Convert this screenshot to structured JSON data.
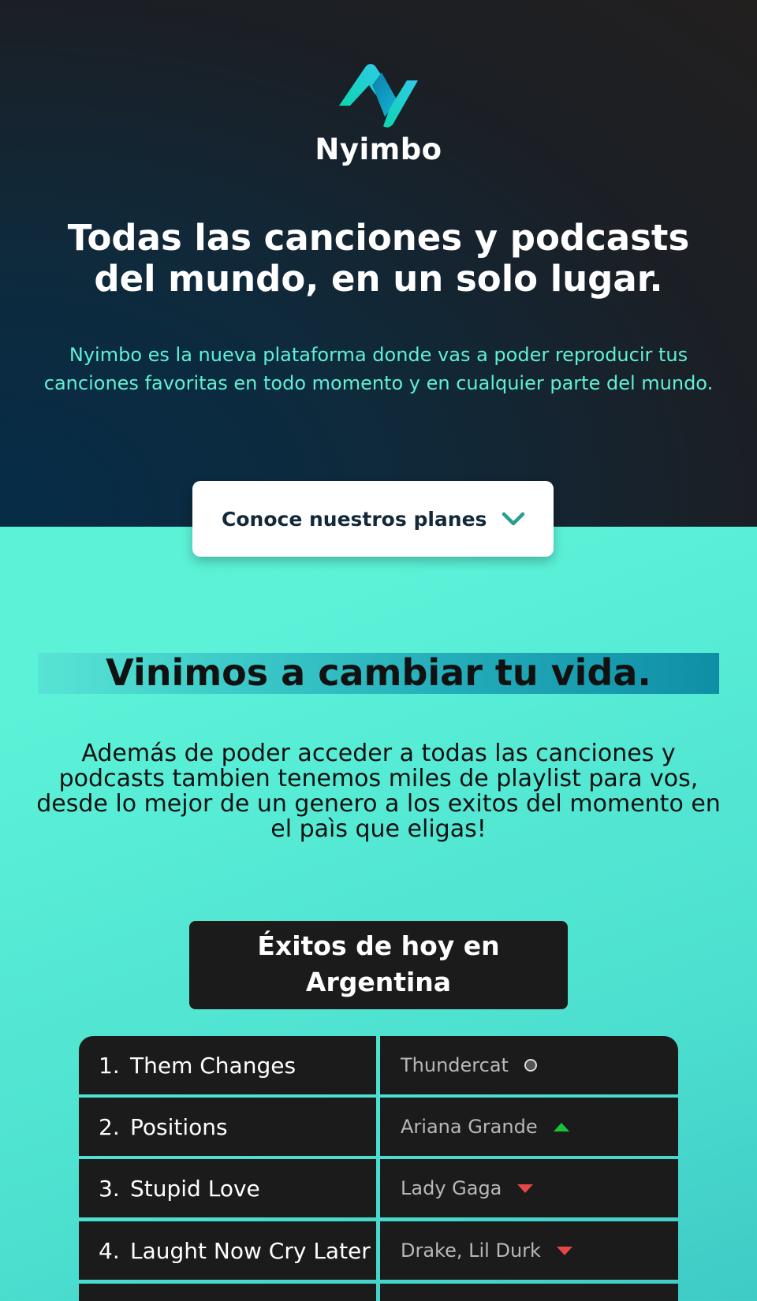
{
  "brand": {
    "name": "Nyimbo",
    "logo_icon": "nyimbo-logo-icon",
    "colors": {
      "accent": "#5ff0d5",
      "dark": "#1b1b1b"
    }
  },
  "hero": {
    "title": "Todas las canciones y podcasts del mundo, en un solo lugar.",
    "subtitle": "Nyimbo es la nueva plataforma donde vas a poder reproducir tus canciones favoritas en todo momento y en cualquier parte del mundo.",
    "cta_label": "Conoce nuestros planes",
    "cta_icon": "chevron-down-icon"
  },
  "about": {
    "title": "Vinimos a cambiar tu vida.",
    "text": "Además de poder acceder a todas las canciones y podcasts tambien tenemos miles de playlist para vos, desde lo mejor de un genero a los exitos del momento en el paìs que eligas!"
  },
  "hits": {
    "title": "Éxitos de hoy en Argentina",
    "rows": [
      {
        "rank": "1.",
        "song": "Them Changes",
        "artist": "Thundercat",
        "trend": "same"
      },
      {
        "rank": "2.",
        "song": "Positions",
        "artist": "Ariana Grande",
        "trend": "up"
      },
      {
        "rank": "3.",
        "song": "Stupid Love",
        "artist": "Lady Gaga",
        "trend": "down"
      },
      {
        "rank": "4.",
        "song": "Laught Now Cry Later",
        "artist": "Drake, Lil Durk",
        "trend": "down"
      },
      {
        "rank": "",
        "song": "",
        "artist": "",
        "trend": "none"
      }
    ]
  }
}
